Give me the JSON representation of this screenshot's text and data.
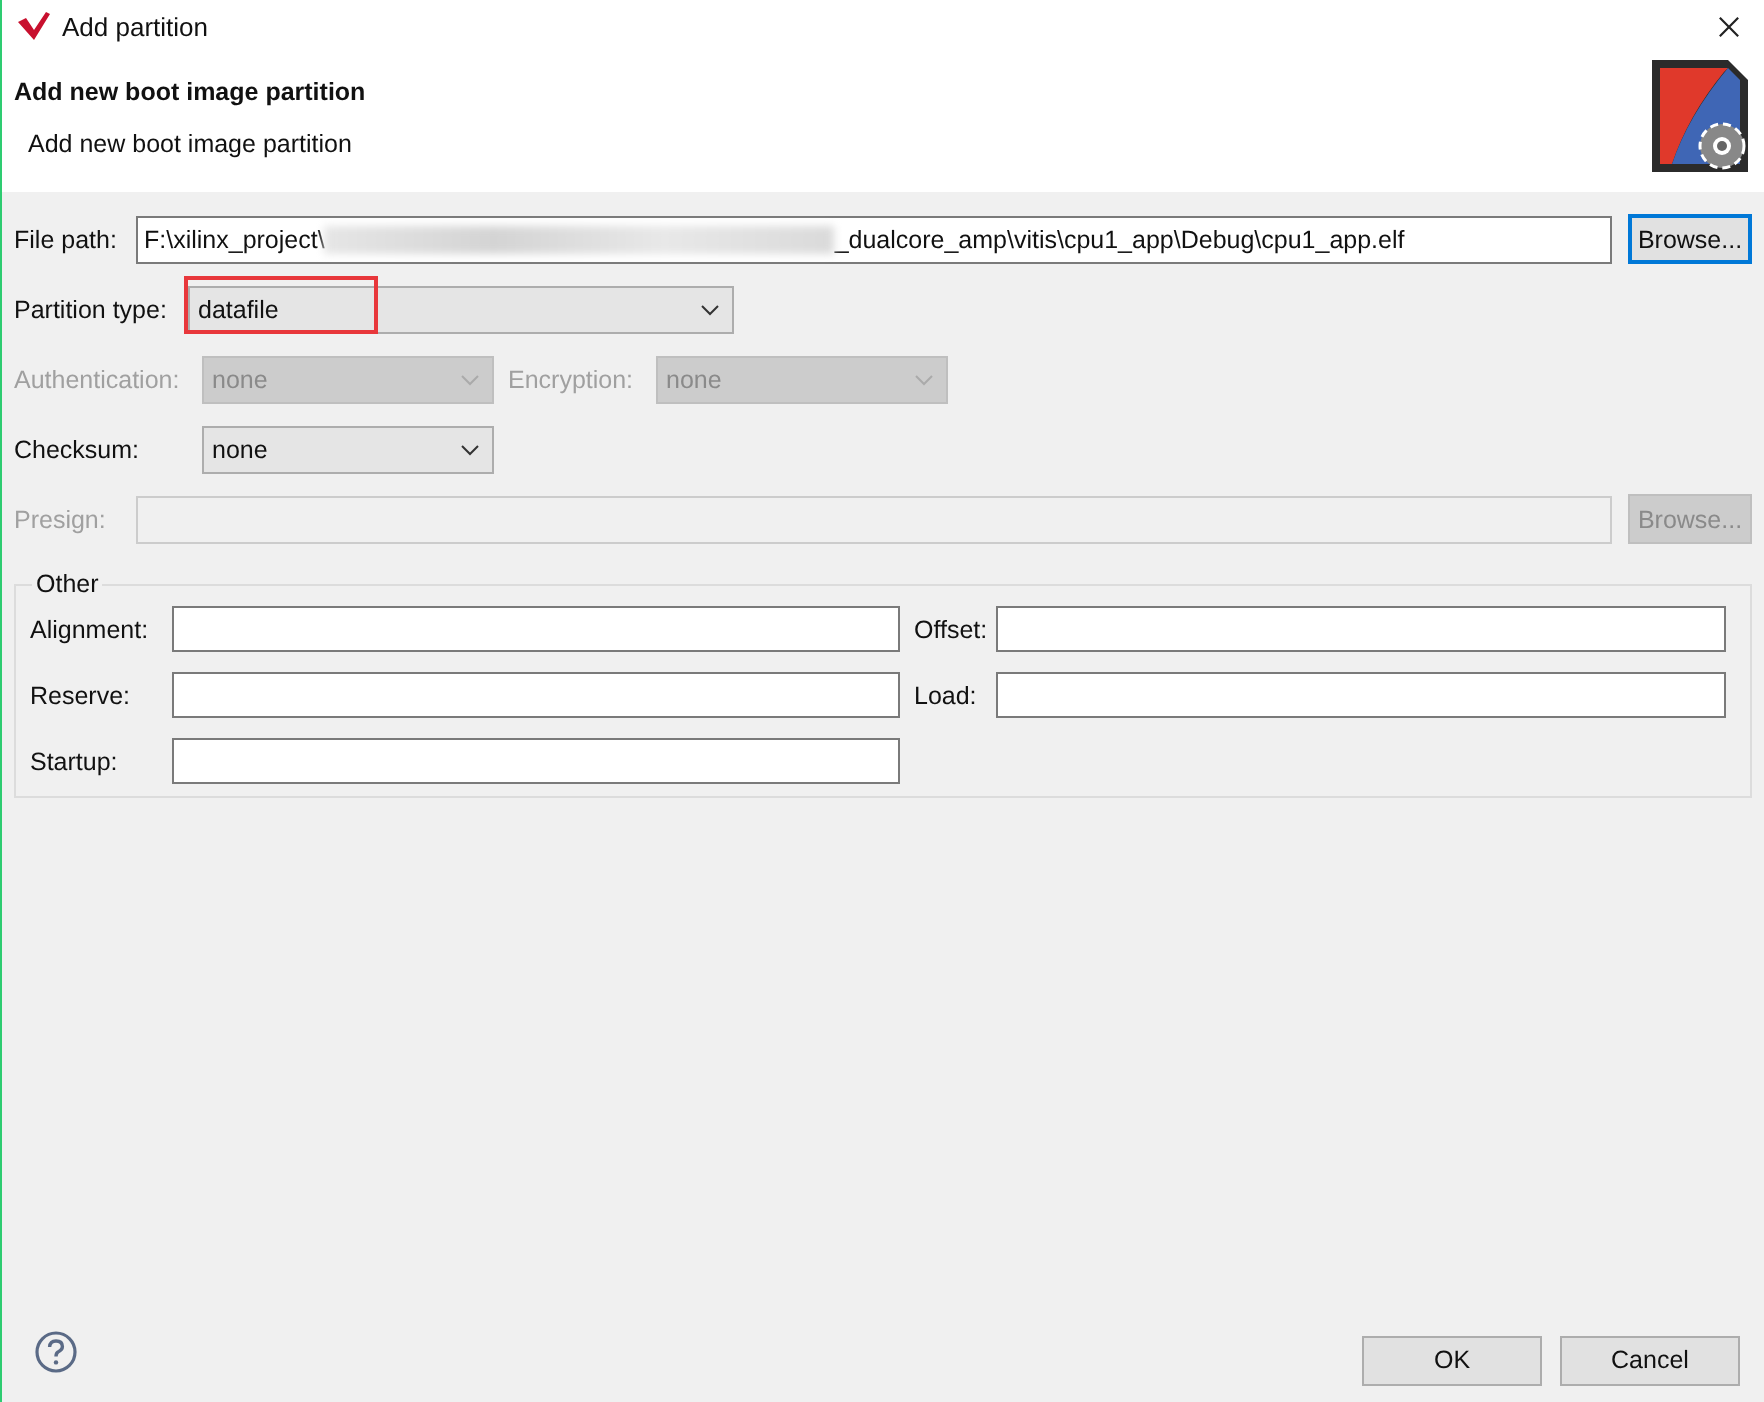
{
  "window": {
    "title": "Add partition"
  },
  "header": {
    "title": "Add new boot image partition",
    "description": "Add new boot image partition"
  },
  "file_path": {
    "label": "File path:",
    "value_start": "F:\\xilinx_project\\",
    "redacted": true,
    "value_end": "_dualcore_amp\\vitis\\cpu1_app\\Debug\\cpu1_app.elf",
    "button": "Browse...",
    "button_focused": true
  },
  "partition_type": {
    "label": "Partition type:",
    "value": "datafile",
    "highlighted": true
  },
  "authentication": {
    "label": "Authentication:",
    "value": "none",
    "disabled": true
  },
  "encryption": {
    "label": "Encryption:",
    "value": "none",
    "disabled": true
  },
  "checksum": {
    "label": "Checksum:",
    "value": "none",
    "disabled": false
  },
  "presign": {
    "label": "Presign:",
    "button": "Browse...",
    "disabled": true
  },
  "other": {
    "title": "Other",
    "fields": [
      {
        "label": "Alignment:"
      },
      {
        "label": "Offset:"
      },
      {
        "label": "Reserve:"
      },
      {
        "label": "Load:"
      },
      {
        "label": "Startup:"
      }
    ]
  },
  "buttons": [
    {
      "label": "OK"
    },
    {
      "label": "Cancel"
    }
  ]
}
